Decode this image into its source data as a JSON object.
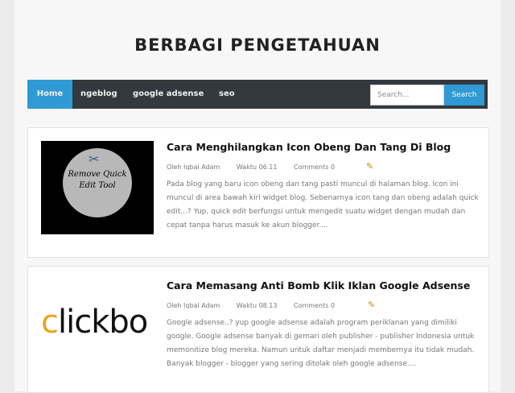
{
  "site": {
    "title": "BERBAGI PENGETAHUAN"
  },
  "nav": {
    "items": [
      "Home",
      "ngeblog",
      "google adsense",
      "seo"
    ],
    "search_placeholder": "Search...",
    "search_button": "Search"
  },
  "posts": [
    {
      "title": "Cara Menghilangkan Icon Obeng Dan Tang Di Blog",
      "author": "Oleh Iqbal Adam",
      "time": "Waktu 06.11",
      "comments": "Comments 0",
      "excerpt": "Pada blog yang baru icon obeng dan tang pasti muncul di halaman blog. Icon ini muncul di area bawah kiri widget blog. Sebenarnya icon tang dan obeng adalah quick edit...? Yup, quick edit berfungsi untuk mengedit suatu widget dengan mudah dan cepat tanpa harus masuk ke akun blogger....",
      "thumbnail_text": "Remove Quick Edit Tool",
      "thumbnail_icon": "tools-icon"
    },
    {
      "title": "Cara Memasang Anti Bomb Klik Iklan Google Adsense",
      "author": "Oleh Iqbal Adam",
      "time": "Waktu 08.13",
      "comments": "Comments 0",
      "excerpt": "Google adsense..? yup google adsense adalah program periklanan yang dimiliki google. Google adsense banyak di gemari oleh publisher - publisher Indonesia untuk memonitize blog mereka. Namun untuk daftar menjadi membernya itu tidak mudah. Banyak blogger - blogger yang sering ditolak oleh google adsense....",
      "thumbnail_text_accent": "c",
      "thumbnail_text": "lickbo",
      "thumbnail_accent_color": "#e7a51d"
    }
  ]
}
